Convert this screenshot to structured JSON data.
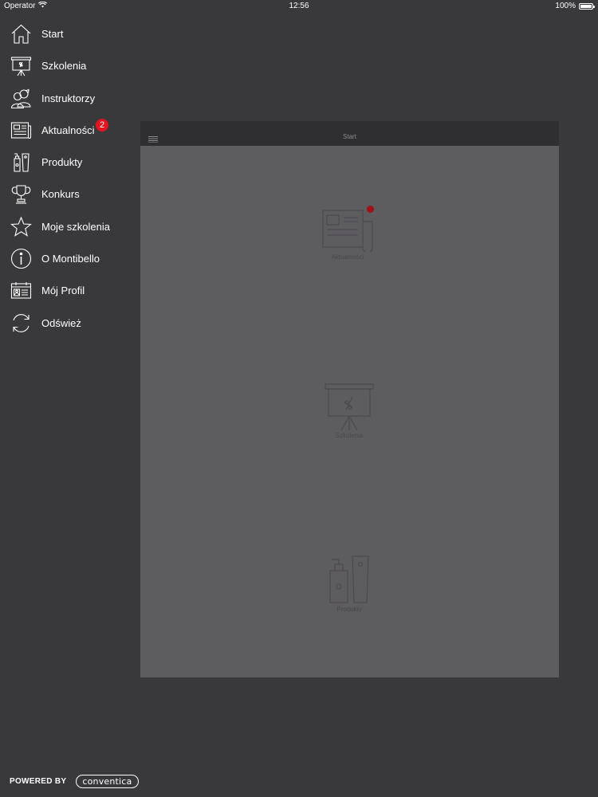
{
  "status_bar": {
    "carrier": "Operator",
    "time": "12:56",
    "battery": "100%"
  },
  "menu": {
    "items": [
      {
        "label": "Start",
        "icon": "home-icon"
      },
      {
        "label": "Szkolenia",
        "icon": "presentation-board-icon"
      },
      {
        "label": "Instruktorzy",
        "icon": "people-icon"
      },
      {
        "label": "Aktualności",
        "icon": "newspaper-icon",
        "badge": "2"
      },
      {
        "label": "Produkty",
        "icon": "bottles-icon"
      },
      {
        "label": "Konkurs",
        "icon": "trophy-icon"
      },
      {
        "label": "Moje szkolenia",
        "icon": "star-icon"
      },
      {
        "label": "O Montibello",
        "icon": "info-icon"
      },
      {
        "label": "Mój Profil",
        "icon": "id-card-icon"
      },
      {
        "label": "Odśwież",
        "icon": "refresh-icon"
      }
    ]
  },
  "main": {
    "title": "Start",
    "tiles": [
      {
        "label": "Aktualności",
        "icon": "newspaper-icon"
      },
      {
        "label": "Szkolenia",
        "icon": "presentation-board-icon"
      },
      {
        "label": "Produkty",
        "icon": "bottles-icon"
      }
    ]
  },
  "footer": {
    "powered_by": "POWERED BY",
    "brand": "conventica"
  },
  "colors": {
    "background": "#39383b",
    "card": "#5d5c5f",
    "card_header": "#2f2e31",
    "badge": "#e2141f"
  }
}
